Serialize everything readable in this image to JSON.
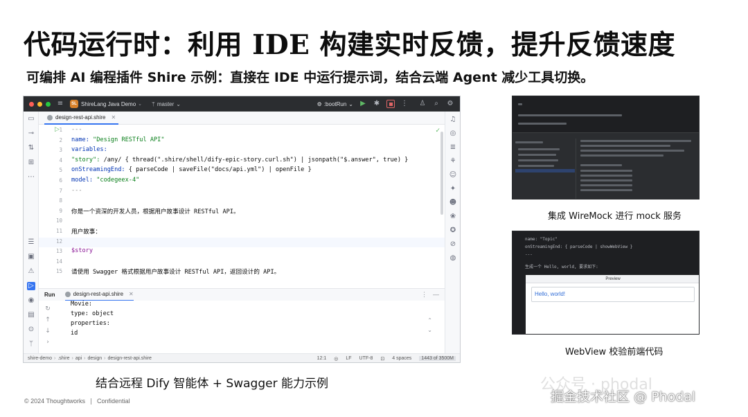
{
  "slide": {
    "title": "代码运行时：利用 IDE 构建实时反馈，提升反馈速度",
    "subtitle": "可编排 AI 编程插件 Shire 示例：直接在 IDE 中运行提示词，结合云端 Agent 减少工具切换。",
    "main_caption": "结合远程 Dify 智能体 + Swagger 能力示例",
    "thumb1_caption": "集成 WireMock 进行 mock 服务",
    "thumb2_caption": "WebView 校验前端代码",
    "footer_copyright": "© 2024 Thoughtworks",
    "footer_confidential": "Confidential",
    "watermark_faint": "公众号 · phodal",
    "watermark": "掘金技术社区 @ Phodal"
  },
  "ide": {
    "project_badge": "SL",
    "project_name": "ShireLang Java Demo",
    "branch": "master",
    "run_config": ":bootRun",
    "file_tab": "design-rest-api.shire",
    "editor_lines": [
      {
        "n": "1",
        "text": "---"
      },
      {
        "n": "2",
        "key": "name: ",
        "val": "\"Design RESTful API\""
      },
      {
        "n": "3",
        "key": "variables:",
        "val": ""
      },
      {
        "n": "4",
        "key": "  \"story\": ",
        "val": "/any/ { thread(\".shire/shell/dify-epic-story.curl.sh\") | jsonpath(\"$.answer\", true) }"
      },
      {
        "n": "5",
        "key": "onStreamingEnd: ",
        "val": "{ parseCode | saveFile(\"docs/api.yml\") | openFile }"
      },
      {
        "n": "6",
        "key": "model: ",
        "val": "\"codegeex-4\""
      },
      {
        "n": "7",
        "text": "---"
      },
      {
        "n": "8",
        "text": ""
      },
      {
        "n": "9",
        "text": "你是一个资深的开发人员，根据用户故事设计 RESTful API。"
      },
      {
        "n": "10",
        "text": ""
      },
      {
        "n": "11",
        "text": "用户故事："
      },
      {
        "n": "12",
        "text": ""
      },
      {
        "n": "13",
        "text": "$story"
      },
      {
        "n": "14",
        "text": ""
      },
      {
        "n": "15",
        "text": "请使用 Swagger 格式根据用户故事设计 RESTful API，返回设计的 API。"
      }
    ],
    "run_label": "Run",
    "run_tab": "design-rest-api.shire",
    "console_lines": [
      "Movie:",
      "  type: object",
      "  properties:",
      "    id"
    ],
    "breadcrumbs": [
      "shire-demo",
      ".shire",
      "api",
      "design",
      "design-rest-api.shire"
    ],
    "status": {
      "position": "12:1",
      "line_sep": "LF",
      "encoding": "UTF-8",
      "indent": "4 spaces",
      "memory": "1443 of 3500M"
    }
  },
  "colors": {
    "accent": "#3574f0",
    "title_bar": "#2b2d30",
    "run_green": "#5fb865",
    "stop_red": "#e06666"
  },
  "thumb2": {
    "code_lines": [
      "name: \"Topic\"",
      "onStreamingEnd: { parseCode | showWebView }",
      "---",
      "生成一个 Hello, world, 要求如下:"
    ],
    "preview_title": "Preview",
    "preview_text": "Hello, world!"
  }
}
